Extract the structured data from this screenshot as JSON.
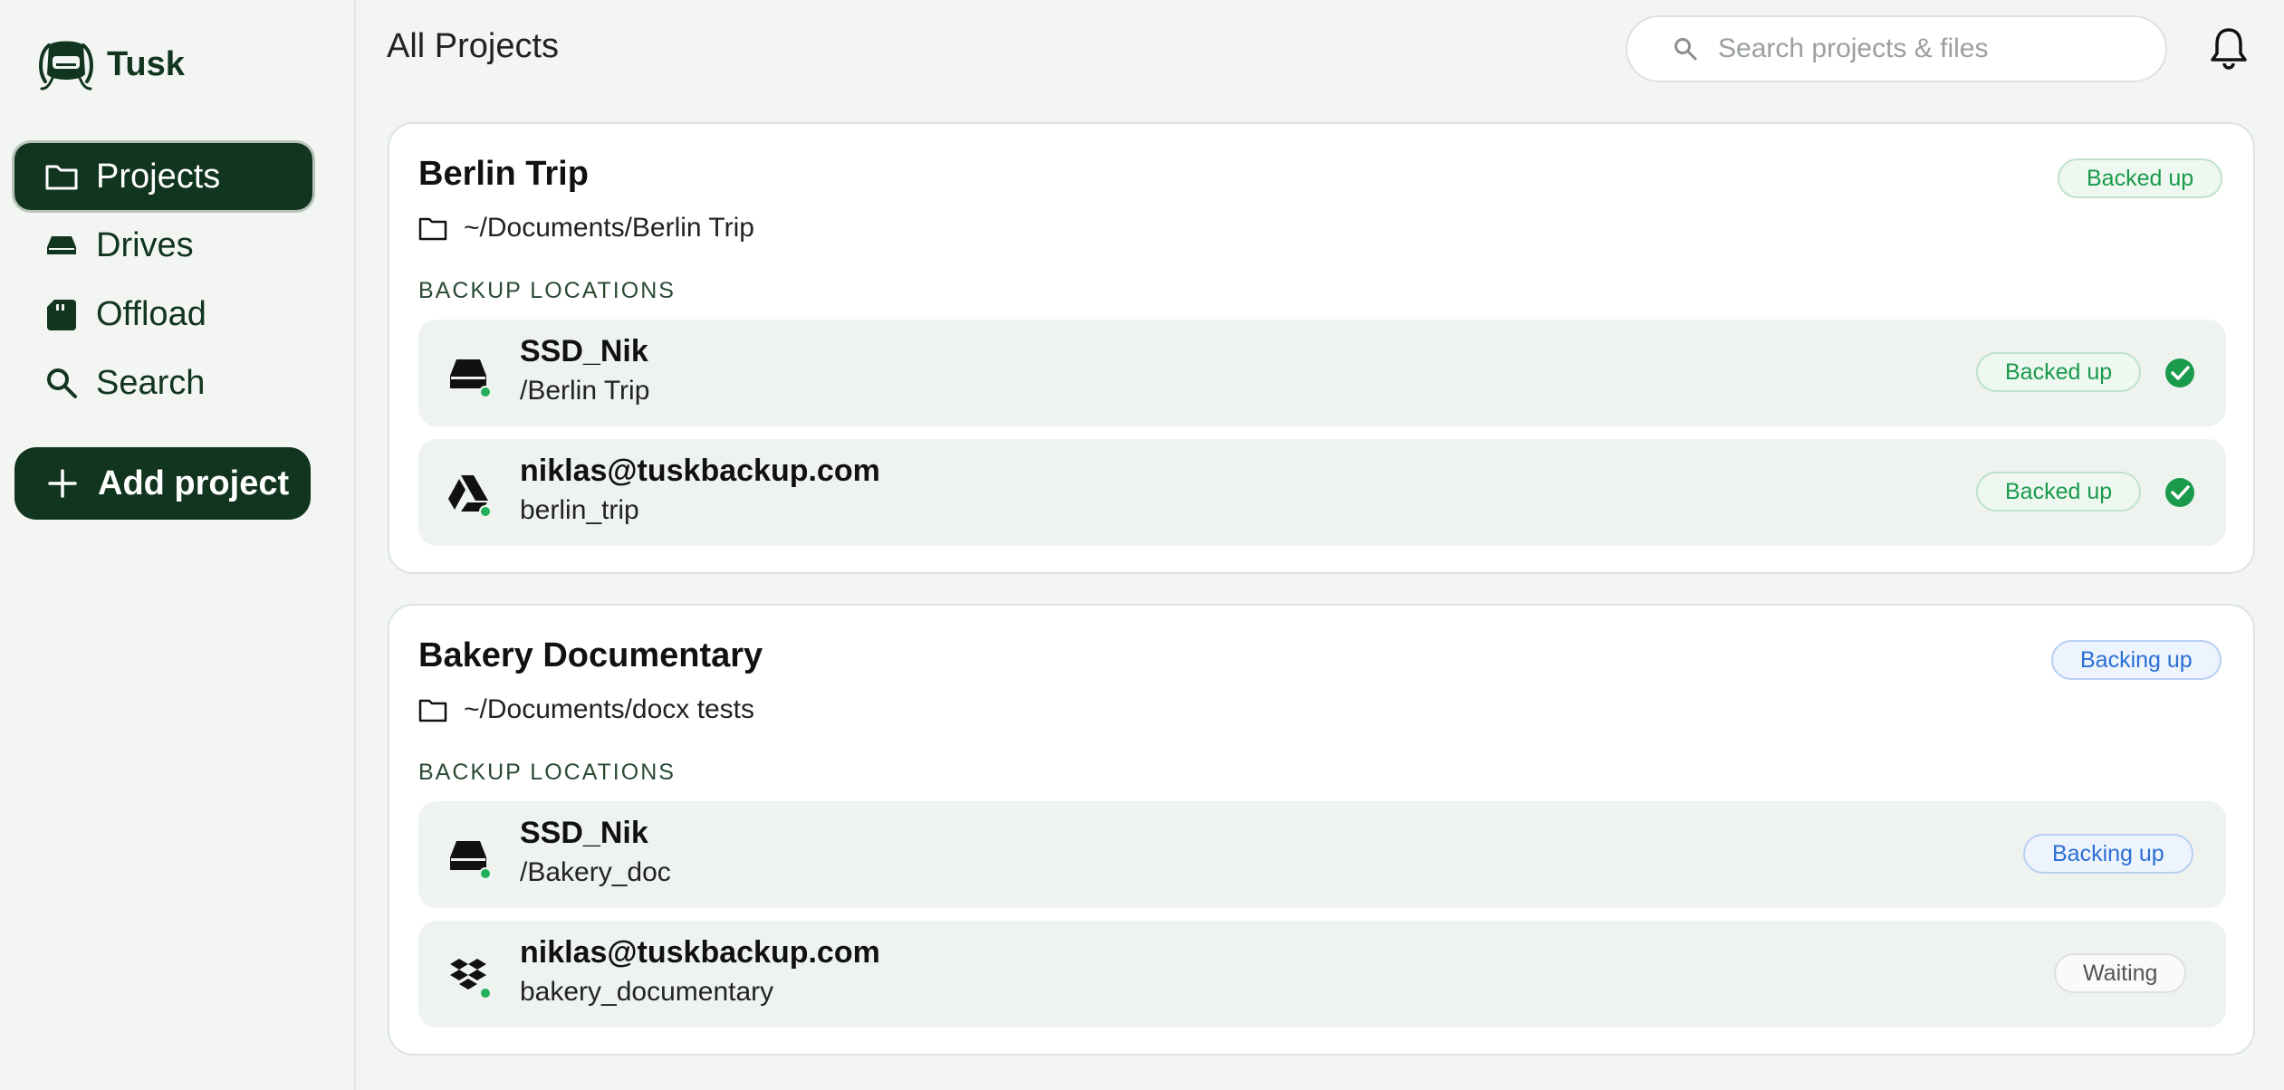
{
  "sidebar": {
    "brand": "Tusk",
    "nav": [
      {
        "label": "Projects",
        "icon": "folder-icon",
        "active": true
      },
      {
        "label": "Drives",
        "icon": "drive-icon",
        "active": false
      },
      {
        "label": "Offload",
        "icon": "sd-card-icon",
        "active": false
      },
      {
        "label": "Search",
        "icon": "search-icon",
        "active": false
      }
    ],
    "add_label": "Add project"
  },
  "header": {
    "title": "All Projects",
    "search_placeholder": "Search projects & files"
  },
  "projects": [
    {
      "name": "Berlin Trip",
      "path": "~/Documents/Berlin Trip",
      "status": "Backed up",
      "section_label": "BACKUP LOCATIONS",
      "locations": [
        {
          "name": "SSD_Nik",
          "sub": "/Berlin Trip",
          "status": "Backed up",
          "icon": "ssd-icon"
        },
        {
          "name": "niklas@tuskbackup.com",
          "sub": "berlin_trip",
          "status": "Backed up",
          "icon": "google-drive-icon"
        }
      ]
    },
    {
      "name": "Bakery Documentary",
      "path": "~/Documents/docx tests",
      "status": "Backing up",
      "section_label": "BACKUP LOCATIONS",
      "locations": [
        {
          "name": "SSD_Nik",
          "sub": "/Bakery_doc",
          "status": "Backing up",
          "icon": "ssd-icon"
        },
        {
          "name": "niklas@tuskbackup.com",
          "sub": "bakery_documentary",
          "status": "Waiting",
          "icon": "dropbox-icon"
        }
      ]
    }
  ],
  "colors": {
    "brand": "#12351f",
    "success": "#1a9a4b",
    "progress": "#2a6fd6",
    "online_dot": "#22b05a"
  }
}
